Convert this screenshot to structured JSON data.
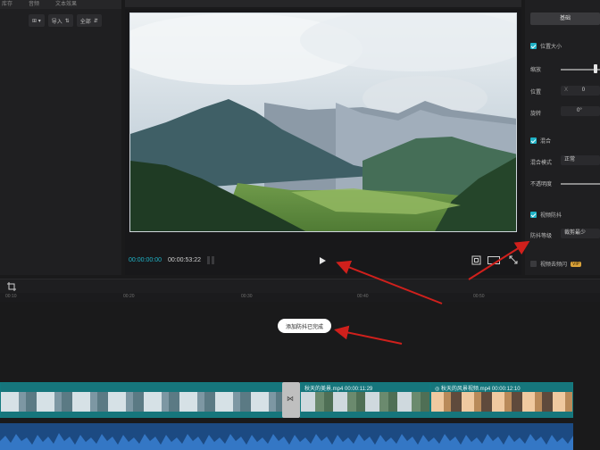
{
  "media_panel": {
    "tabs": [
      "库存",
      "音频",
      "文本效果"
    ],
    "toolbar": {
      "view_label": "⊞ ▾",
      "filter_label": "导入",
      "sort_label": "全部"
    }
  },
  "player": {
    "current_time": "00:00:00:00",
    "total_time": "00:00:53:22",
    "play_icon": "play-icon"
  },
  "properties": {
    "header_button": "基础",
    "sections": {
      "position_size": "位置大小",
      "blend": "混合",
      "stabilize": "视频防抖",
      "remove_flicker": "视频去频闪"
    },
    "fields": {
      "scale_label": "缩放",
      "position_label": "位置",
      "position_x_prefix": "X",
      "position_x": "0",
      "rotate_label": "旋转",
      "rotate_value": "0°",
      "blend_mode_label": "混合模式",
      "blend_mode_value": "正常",
      "opacity_label": "不透明度",
      "stabilize_label": "防抖等级",
      "stabilize_value": "裁剪最少",
      "vip_badge": "VIP"
    }
  },
  "timeline": {
    "ruler_ticks": [
      "00:10",
      "00:20",
      "00:30",
      "00:40",
      "00:50"
    ],
    "toast": "添加防抖已完成",
    "clips": [
      {
        "label": ""
      },
      {
        "label": "秋天的美景.mp4  00:00:11:29"
      },
      {
        "label": "◎ 秋天的风景视频.mp4  00:00:12:10"
      }
    ]
  },
  "colors": {
    "accent": "#1fb2c6",
    "clip": "#16767c",
    "audio": "#1c4a82",
    "annotation_arrow": "#d0201c"
  }
}
